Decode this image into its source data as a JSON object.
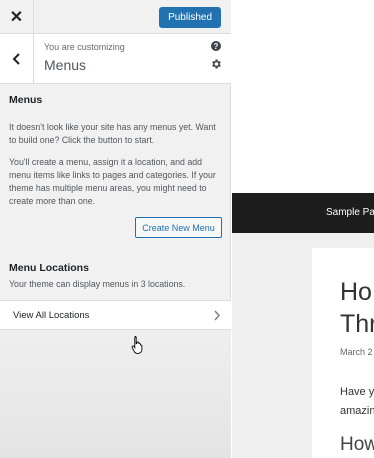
{
  "header": {
    "close_glyph": "✕",
    "publish_label": "Published",
    "customizing_label": "You are customizing",
    "section_title": "Menus",
    "help_glyph": "?"
  },
  "menus": {
    "heading": "Menus",
    "no_menus_text": "It doesn't look like your site has any menus yet. Want to build one? Click the button to start.",
    "instructions_text": "You'll create a menu, assign it a location, and add menu items like links to pages and categories. If your theme has multiple menu areas, you might need to create more than one.",
    "create_button_label": "Create New Menu"
  },
  "locations": {
    "heading": "Menu Locations",
    "description": "Your theme can display menus in 3 locations.",
    "view_all_label": "View All Locations"
  },
  "preview": {
    "nav_link": "Sample Pa",
    "post_title_line1": "Ho",
    "post_title_line2": "Thr",
    "post_date": "March 2",
    "excerpt_line1": "Have y",
    "excerpt_line2": "amazin",
    "heading2": "How"
  },
  "colors": {
    "accent": "#2271b1",
    "sidebar_bg": "#f1f1f1",
    "nav_bg": "#1d1d1d"
  },
  "icons": [
    "close-icon",
    "back-arrow-icon",
    "help-icon",
    "gear-icon",
    "chevron-right-icon",
    "hand-cursor-icon"
  ]
}
